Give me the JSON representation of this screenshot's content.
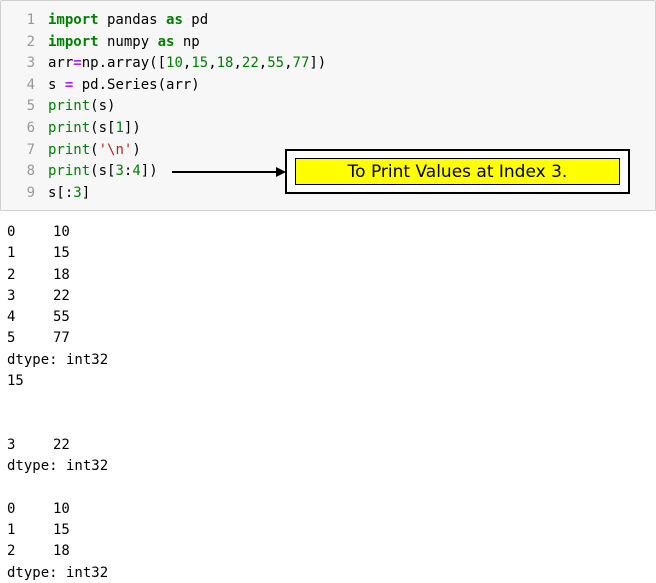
{
  "code_cell": {
    "lines": [
      {
        "n": "1",
        "parts": [
          {
            "t": "import",
            "c": "kw"
          },
          {
            "t": " pandas ",
            "c": "plain"
          },
          {
            "t": "as",
            "c": "kw"
          },
          {
            "t": " pd",
            "c": "plain"
          }
        ]
      },
      {
        "n": "2",
        "parts": [
          {
            "t": "import",
            "c": "kw"
          },
          {
            "t": " numpy ",
            "c": "plain"
          },
          {
            "t": "as",
            "c": "kw"
          },
          {
            "t": " np",
            "c": "plain"
          }
        ]
      },
      {
        "n": "3",
        "parts": [
          {
            "t": "arr",
            "c": "plain"
          },
          {
            "t": "=",
            "c": "op"
          },
          {
            "t": "np.array([",
            "c": "plain"
          },
          {
            "t": "10",
            "c": "num"
          },
          {
            "t": ",",
            "c": "plain"
          },
          {
            "t": "15",
            "c": "num"
          },
          {
            "t": ",",
            "c": "plain"
          },
          {
            "t": "18",
            "c": "num"
          },
          {
            "t": ",",
            "c": "plain"
          },
          {
            "t": "22",
            "c": "num"
          },
          {
            "t": ",",
            "c": "plain"
          },
          {
            "t": "55",
            "c": "num"
          },
          {
            "t": ",",
            "c": "plain"
          },
          {
            "t": "77",
            "c": "num"
          },
          {
            "t": "])",
            "c": "plain"
          }
        ]
      },
      {
        "n": "4",
        "parts": [
          {
            "t": "s ",
            "c": "plain"
          },
          {
            "t": "=",
            "c": "op"
          },
          {
            "t": " pd.Series(arr)",
            "c": "plain"
          }
        ]
      },
      {
        "n": "5",
        "parts": [
          {
            "t": "print",
            "c": "num"
          },
          {
            "t": "(s)",
            "c": "plain"
          }
        ]
      },
      {
        "n": "6",
        "parts": [
          {
            "t": "print",
            "c": "num"
          },
          {
            "t": "(s[",
            "c": "plain"
          },
          {
            "t": "1",
            "c": "num"
          },
          {
            "t": "])",
            "c": "plain"
          }
        ]
      },
      {
        "n": "7",
        "parts": [
          {
            "t": "print",
            "c": "num"
          },
          {
            "t": "(",
            "c": "plain"
          },
          {
            "t": "'\\n'",
            "c": "str"
          },
          {
            "t": ")",
            "c": "plain"
          }
        ]
      },
      {
        "n": "8",
        "parts": [
          {
            "t": "print",
            "c": "num"
          },
          {
            "t": "(s[",
            "c": "plain"
          },
          {
            "t": "3",
            "c": "num"
          },
          {
            "t": ":",
            "c": "plain"
          },
          {
            "t": "4",
            "c": "num"
          },
          {
            "t": "])",
            "c": "plain"
          }
        ]
      },
      {
        "n": "9",
        "parts": [
          {
            "t": "s[:",
            "c": "plain"
          },
          {
            "t": "3",
            "c": "num"
          },
          {
            "t": "]",
            "c": "plain"
          }
        ]
      }
    ]
  },
  "callout": {
    "text": "To Print Values at Index 3."
  },
  "output": {
    "rows": [
      {
        "idx": "0",
        "val": "10"
      },
      {
        "idx": "1",
        "val": "15"
      },
      {
        "idx": "2",
        "val": "18"
      },
      {
        "idx": "3",
        "val": "22"
      },
      {
        "idx": "4",
        "val": "55"
      },
      {
        "idx": "5",
        "val": "77"
      },
      {
        "text": "dtype: int32"
      },
      {
        "text": "15"
      },
      {
        "text": ""
      },
      {
        "text": ""
      },
      {
        "idx": "3",
        "val": "22"
      },
      {
        "text": "dtype: int32"
      },
      {
        "text": ""
      },
      {
        "idx": "0",
        "val": "10"
      },
      {
        "idx": "1",
        "val": "15"
      },
      {
        "idx": "2",
        "val": "18"
      },
      {
        "text": "dtype: int32"
      }
    ]
  }
}
